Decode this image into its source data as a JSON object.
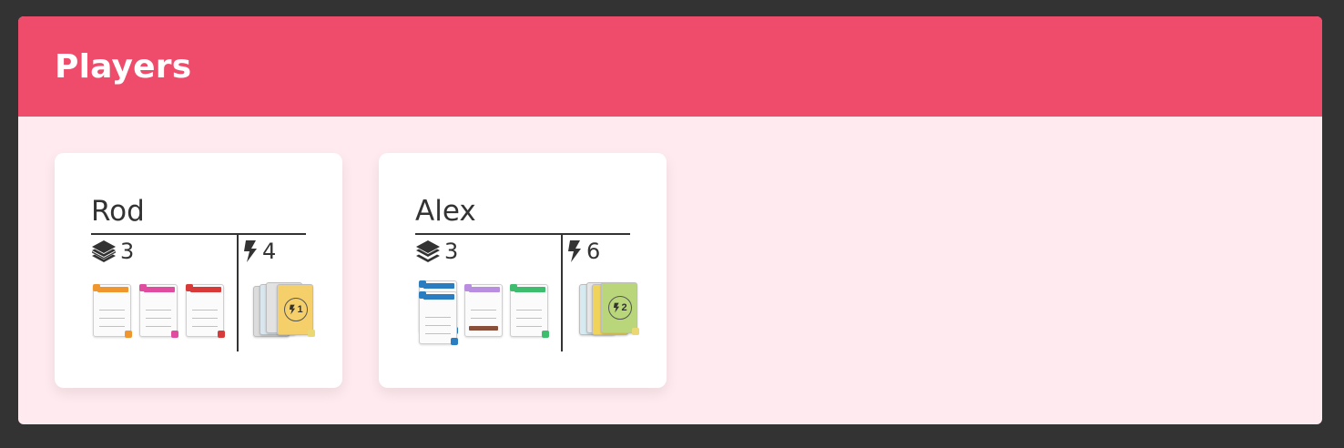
{
  "panel": {
    "title": "Players"
  },
  "colors": {
    "frame": "#333333",
    "header": "#ef4b6b",
    "panel_background": "#ffebef",
    "card_background": "#ffffff",
    "text": "#333333"
  },
  "icons": {
    "cards": "stacked-cards-icon",
    "energy": "lightning-icon"
  },
  "players": [
    {
      "name": "Rod",
      "cards_count": "3",
      "energy_count": "4",
      "hand": [
        {
          "color": "#f0962e"
        },
        {
          "color": "#e04c9f"
        },
        {
          "color": "#d83a3a"
        }
      ],
      "pile": {
        "top_value": "1",
        "top_color": "#f5d06a"
      }
    },
    {
      "name": "Alex",
      "cards_count": "3",
      "energy_count": "6",
      "hand": [
        {
          "color": "#2a7dc0"
        },
        {
          "color": "#b98de0"
        },
        {
          "color": "#3ebd6f"
        }
      ],
      "pile": {
        "top_value": "2",
        "top_color": "#b9d77a"
      }
    }
  ]
}
